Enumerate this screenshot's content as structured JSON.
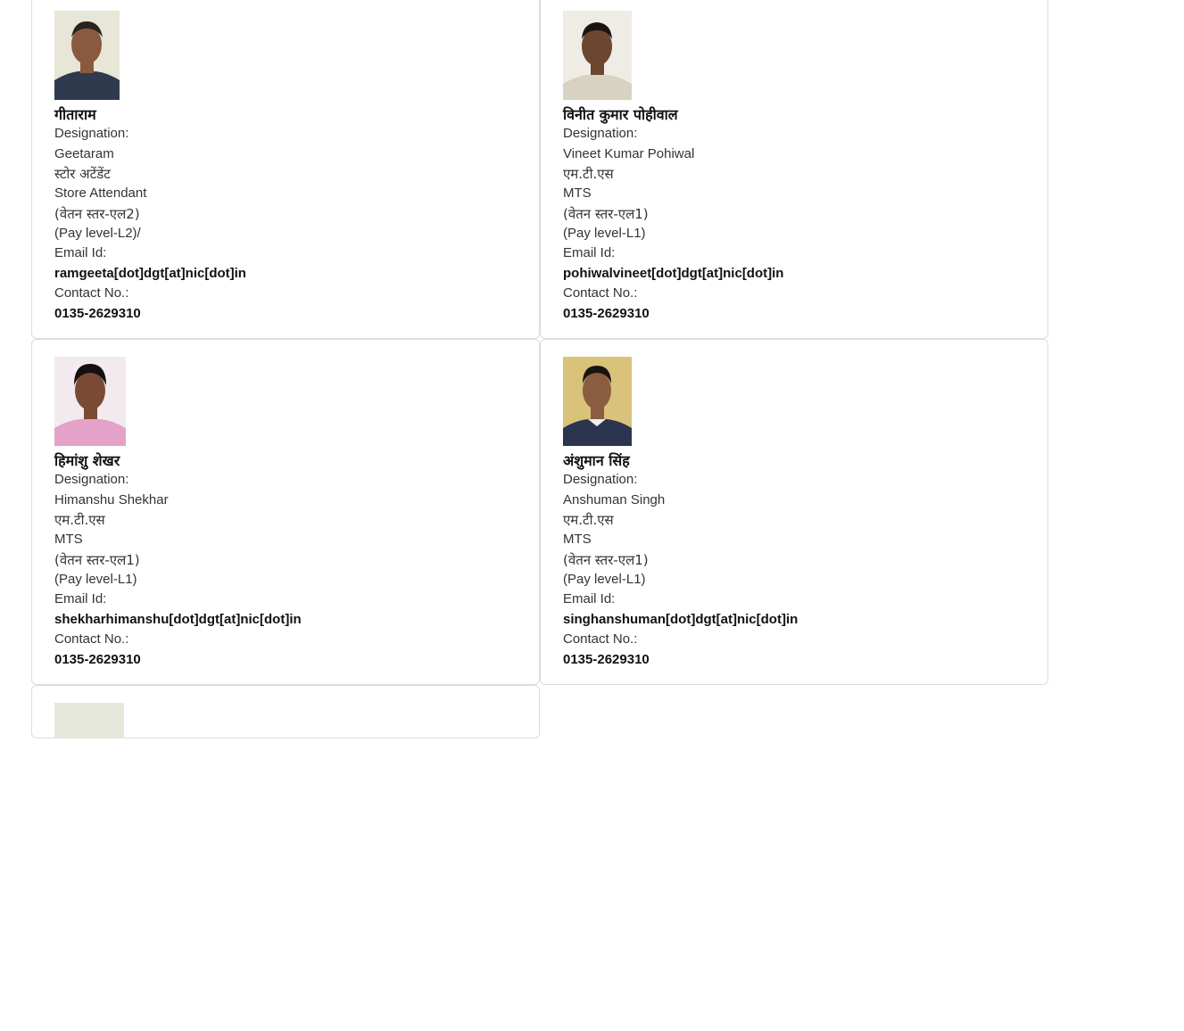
{
  "employees": [
    {
      "name_hi": "गीताराम",
      "designation_label": "Designation:",
      "name_en": "Geetaram",
      "designation_hi": "स्टोर अटेंडेंट",
      "designation_en": "Store Attendant",
      "pay_hi": "(वेतन स्तर-एल2)",
      "pay_en": "(Pay level-L2)/",
      "email_label": "Email Id:",
      "email": "ramgeeta[dot]dgt[at]nic[dot]in",
      "contact_label": "Contact No.:",
      "contact": "0135-2629310",
      "photo": {
        "bg": "#e8e6d6",
        "shirt": "#2f3a4e",
        "skin": "#8a5a40",
        "hair": "#2a2220"
      }
    },
    {
      "name_hi": "विनीत कुमार पोहीवाल",
      "designation_label": "Designation:",
      "name_en": "Vineet Kumar Pohiwal",
      "designation_hi": "एम.टी.एस",
      "designation_en": "MTS",
      "pay_hi": "(वेतन स्तर-एल1)",
      "pay_en": "(Pay level-L1)",
      "email_label": "Email Id:",
      "email": "pohiwalvineet[dot]dgt[at]nic[dot]in",
      "contact_label": "Contact No.:",
      "contact": "0135-2629310",
      "photo": {
        "bg": "#efece6",
        "shirt": "#d8d2c2",
        "skin": "#6b4630",
        "hair": "#1a1512"
      }
    },
    {
      "name_hi": "हिमांशु शेखर",
      "designation_label": "Designation:",
      "name_en": "Himanshu Shekhar",
      "designation_hi": "एम.टी.एस",
      "designation_en": "MTS",
      "pay_hi": "(वेतन स्तर-एल1)",
      "pay_en": "(Pay level-L1)",
      "email_label": "Email Id:",
      "email": "shekharhimanshu[dot]dgt[at]nic[dot]in",
      "contact_label": "Contact No.:",
      "contact": "0135-2629310",
      "photo": {
        "bg": "#f3eaf0",
        "shirt": "#e4a2c8",
        "skin": "#7a4a34",
        "hair": "#141010"
      }
    },
    {
      "name_hi": "अंशुमान सिंह",
      "designation_label": "Designation:",
      "name_en": "Anshuman Singh",
      "designation_hi": "एम.टी.एस",
      "designation_en": "MTS",
      "pay_hi": "(वेतन स्तर-एल1)",
      "pay_en": "(Pay level-L1)",
      "email_label": "Email Id:",
      "email": "singhanshuman[dot]dgt[at]nic[dot]in",
      "contact_label": "Contact No.:",
      "contact": "0135-2629310",
      "photo": {
        "bg": "#d9c27a",
        "shirt": "#2b3550",
        "skin": "#8a5d40",
        "hair": "#1a1410"
      }
    }
  ]
}
